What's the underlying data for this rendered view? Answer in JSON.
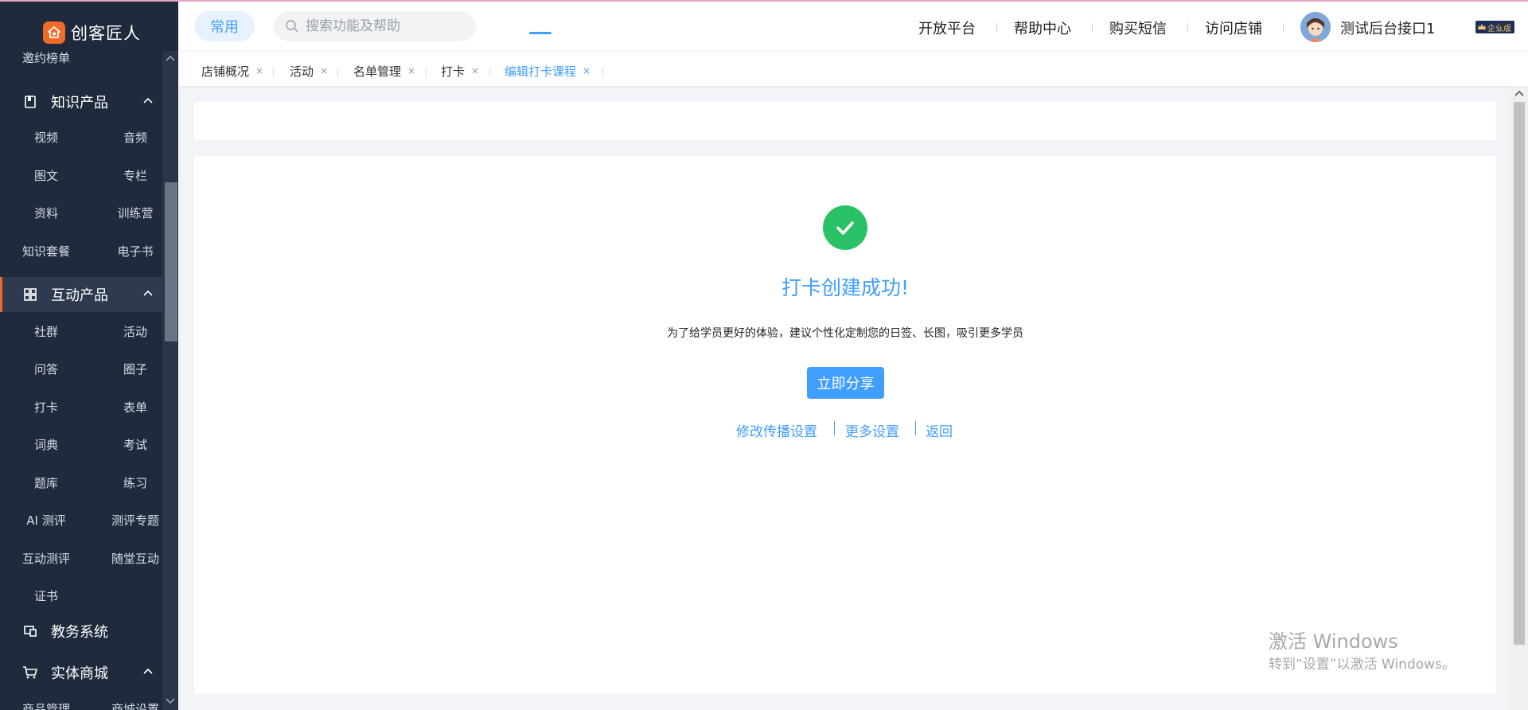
{
  "brand": {
    "name": "创客匠人"
  },
  "sidebar": {
    "partial_top_item": "邀约榜单",
    "groups": [
      {
        "label": "知识产品",
        "icon": "book-icon",
        "items": [
          "视频",
          "音频",
          "图文",
          "专栏",
          "资料",
          "训练营",
          "知识套餐",
          "电子书"
        ]
      },
      {
        "label": "互动产品",
        "icon": "grid-icon",
        "active": true,
        "items": [
          "社群",
          "活动",
          "问答",
          "圈子",
          "打卡",
          "表单",
          "词典",
          "考试",
          "题库",
          "练习",
          "AI 测评",
          "测评专题",
          "互动测评",
          "随堂互动",
          "证书"
        ]
      },
      {
        "label": "教务系统",
        "icon": "monitor-icon"
      },
      {
        "label": "实体商城",
        "icon": "cart-icon",
        "items": [
          "商品管理",
          "商城设置"
        ]
      }
    ]
  },
  "header": {
    "common_label": "常用",
    "search_placeholder": "搜索功能及帮助",
    "nav": [
      "开放平台",
      "帮助中心",
      "购买短信",
      "访问店铺"
    ],
    "user_name": "测试后台接口1",
    "badge": "企业版"
  },
  "tabs": [
    {
      "label": "店铺概况",
      "active": false
    },
    {
      "label": "活动",
      "active": false
    },
    {
      "label": "名单管理",
      "active": false
    },
    {
      "label": "打卡",
      "active": false
    },
    {
      "label": "编辑打卡课程",
      "active": true
    }
  ],
  "main": {
    "success_title": "打卡创建成功!",
    "description": "为了给学员更好的体验，建议个性化定制您的日签、长图，吸引更多学员",
    "share_button": "立即分享",
    "links": [
      "修改传播设置",
      "更多设置",
      "返回"
    ]
  },
  "watermark": {
    "line1": "激活 Windows",
    "line2": "转到“设置”以激活 Windows。"
  },
  "colors": {
    "accent": "#409eff",
    "success": "#2bc166",
    "sidebar_bg": "#1f2a3d",
    "brand_orange": "#f26a2a"
  }
}
